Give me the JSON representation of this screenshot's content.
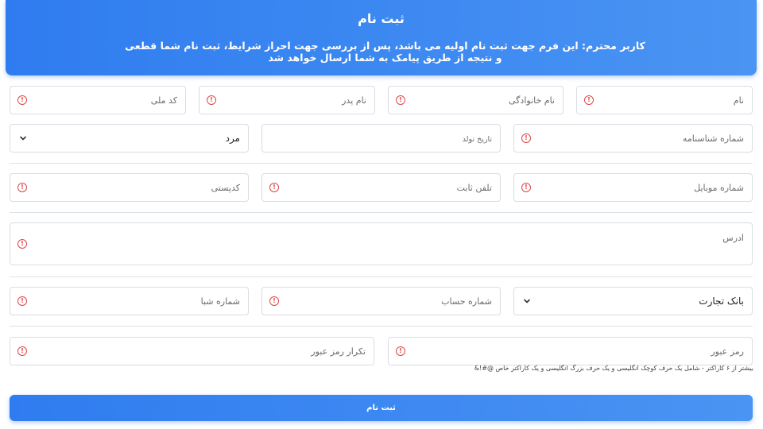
{
  "header": {
    "title": "ثبت نام",
    "subtitle": "کاربر محترم: این فرم جهت ثبت نام اولیه می باشد، پس از بررسی جهت احراز شرایط، ثبت نام شما قطعی و نتیجه از طریق پیامک به شما ارسال خواهد شد"
  },
  "fields": {
    "first_name": {
      "placeholder": "نام",
      "value": ""
    },
    "last_name": {
      "placeholder": "نام خانوادگی",
      "value": ""
    },
    "father_name": {
      "placeholder": "نام پدر",
      "value": ""
    },
    "national_code": {
      "placeholder": "کد ملی",
      "value": ""
    },
    "id_number": {
      "placeholder": "شماره شناسنامه",
      "value": ""
    },
    "birth_date": {
      "placeholder": "تاریخ تولد",
      "value": ""
    },
    "gender": {
      "selected": "مرد"
    },
    "mobile": {
      "placeholder": "شماره موبایل",
      "value": ""
    },
    "phone": {
      "placeholder": "تلفن ثابت",
      "value": ""
    },
    "postal_code": {
      "placeholder": "کدپستی",
      "value": ""
    },
    "address": {
      "placeholder": "ادرس",
      "value": ""
    },
    "bank": {
      "selected": "بانک تجارت"
    },
    "account_number": {
      "placeholder": "شماره حساب",
      "value": ""
    },
    "sheba": {
      "placeholder": "شماره شبا",
      "value": ""
    },
    "password": {
      "placeholder": "رمز عبور",
      "value": ""
    },
    "password_confirm": {
      "placeholder": "تکرار رمز عبور",
      "value": ""
    }
  },
  "password_hint": "بیشتر از ۶ کاراکتر - شامل یک حرف کوچک انگلیسی و یک حرف بزرگ انگلیسی و یک کاراکتر خاص @#!&",
  "error_glyph": "!",
  "submit_label": "ثبت نام",
  "colors": {
    "accent": "#3b87f1",
    "error": "#e04545"
  }
}
